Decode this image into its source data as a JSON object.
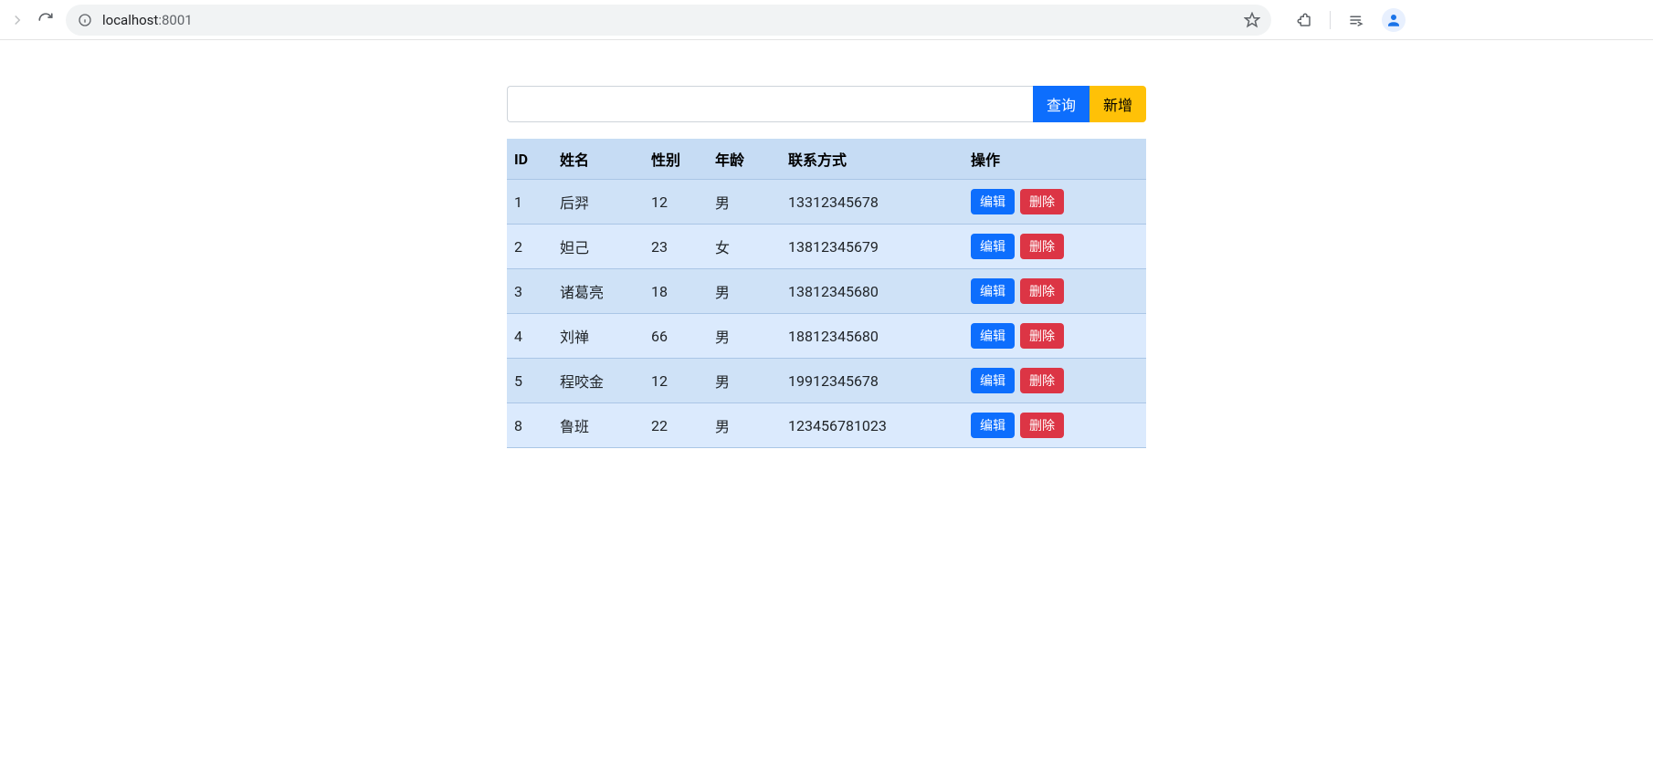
{
  "browser": {
    "url_host": "localhost",
    "url_path": ":8001"
  },
  "search": {
    "value": "",
    "query_btn": "查询",
    "add_btn": "新增"
  },
  "columns": {
    "id": "ID",
    "name": "姓名",
    "gender": "性别",
    "age": "年龄",
    "contact": "联系方式",
    "actions": "操作"
  },
  "action_labels": {
    "edit": "编辑",
    "delete": "删除"
  },
  "rows": [
    {
      "id": "1",
      "name": "后羿",
      "gender": "12",
      "age": "男",
      "contact": "13312345678"
    },
    {
      "id": "2",
      "name": "妲己",
      "gender": "23",
      "age": "女",
      "contact": "13812345679"
    },
    {
      "id": "3",
      "name": "诸葛亮",
      "gender": "18",
      "age": "男",
      "contact": "13812345680"
    },
    {
      "id": "4",
      "name": "刘禅",
      "gender": "66",
      "age": "男",
      "contact": "18812345680"
    },
    {
      "id": "5",
      "name": "程咬金",
      "gender": "12",
      "age": "男",
      "contact": "19912345678"
    },
    {
      "id": "8",
      "name": "鲁班",
      "gender": "22",
      "age": "男",
      "contact": "123456781023"
    }
  ]
}
